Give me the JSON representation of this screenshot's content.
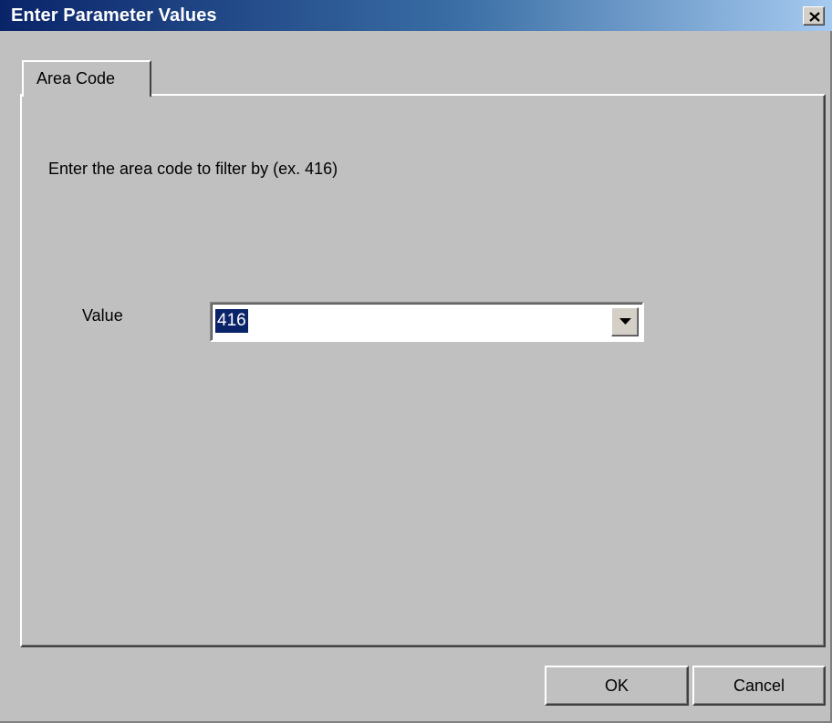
{
  "window": {
    "title": "Enter Parameter Values",
    "close_icon": "close-icon"
  },
  "tabs": [
    {
      "label": "Area Code",
      "active": true
    }
  ],
  "panel": {
    "prompt": "Enter the area code to filter by (ex. 416)",
    "value_label": "Value",
    "value": "416",
    "dropdown_icon": "chevron-down-icon"
  },
  "buttons": {
    "ok_label": "OK",
    "cancel_label": "Cancel"
  },
  "colors": {
    "titlebar_start": "#0a246a",
    "titlebar_end": "#a6caf0",
    "dialog_face": "#c0c0c0",
    "selection": "#0a246a"
  }
}
